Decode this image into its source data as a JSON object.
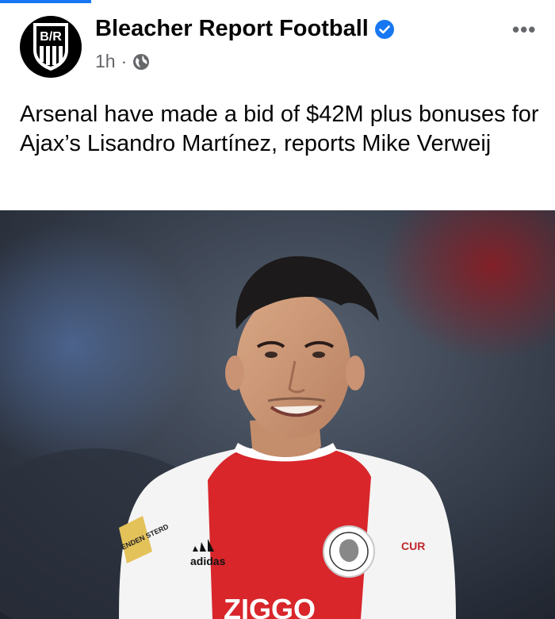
{
  "post": {
    "page_name": "Bleacher Report Football",
    "logo_text": "B/R",
    "time": "1h",
    "separator": "·",
    "more_label": "•••",
    "caption": "Arsenal have made a bid of $42M plus bonuses for Ajax’s Lisandro Martínez, reports Mike Verweij",
    "icons": {
      "verified": "verified-badge-icon",
      "audience": "globe-icon",
      "more": "more-options-icon"
    },
    "colors": {
      "brand_blue": "#1877f2",
      "text": "#050505",
      "meta": "#65676b"
    }
  },
  "photo": {
    "sponsor_text": "ZIGGO",
    "kit_brand": "adidas",
    "patch_text": "ENDEN STERD",
    "sleeve_text": "CUR"
  }
}
